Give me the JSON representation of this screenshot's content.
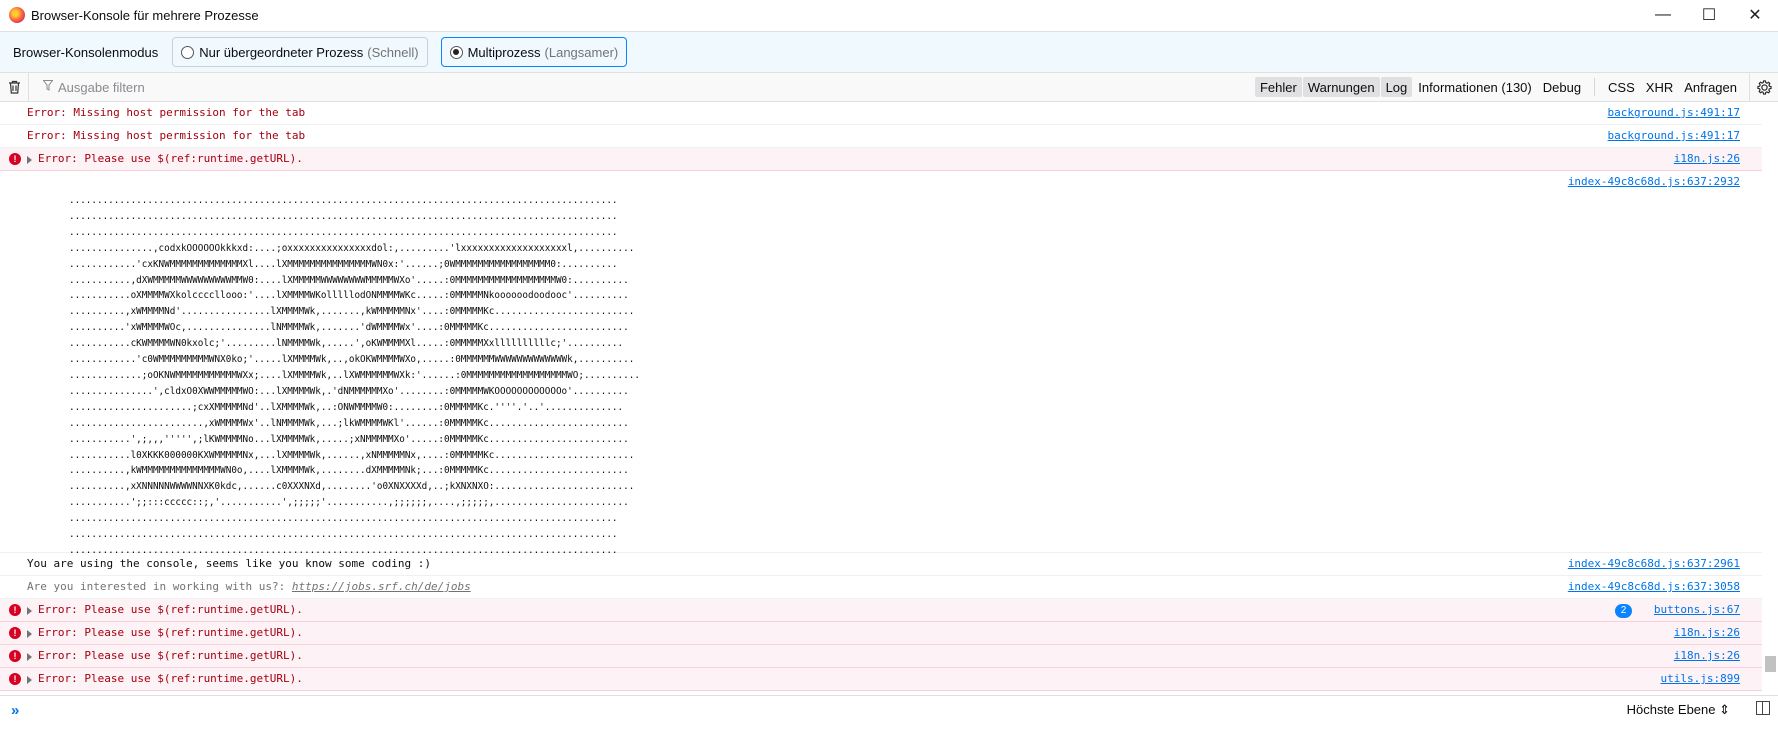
{
  "window": {
    "title": "Browser-Konsole für mehrere Prozesse",
    "minimize": "—",
    "maximize": "☐",
    "close": "✕"
  },
  "modebar": {
    "label": "Browser-Konsolenmodus",
    "option1": {
      "label": "Nur übergeordneter Prozess",
      "hint": "(Schnell)",
      "selected": false
    },
    "option2": {
      "label": "Multiprozess",
      "hint": "(Langsamer)",
      "selected": true
    }
  },
  "toolbar": {
    "filter_placeholder": "Ausgabe filtern",
    "levels": [
      {
        "label": "Fehler",
        "checked": true
      },
      {
        "label": "Warnungen",
        "checked": true
      },
      {
        "label": "Log",
        "checked": true
      },
      {
        "label": "Informationen (130)",
        "checked": false
      },
      {
        "label": "Debug",
        "checked": false
      }
    ],
    "requests": [
      "CSS",
      "XHR",
      "Anfragen"
    ]
  },
  "messages": {
    "m1": {
      "text": "Error: Missing host permission for the tab",
      "source": "background.js:491:17"
    },
    "m2": {
      "text": "Error: Missing host permission for the tab",
      "source": "background.js:491:17"
    },
    "m3": {
      "text": "Error: Please use $(ref:runtime.getURL).",
      "source": "i18n.js:26"
    },
    "ascii_source": "index-49c8c68d.js:637:2932",
    "ascii_art": "..................................................................................................\n..................................................................................................\n..................................................................................................\n...............,codxkOOOOOOkkkxd:....;oxxxxxxxxxxxxxxxdol:,.........'lxxxxxxxxxxxxxxxxxxxl,..........\n............'cxKNWMMMMMMMMMMMMMXl....lXMMMMMMMMMMMMMMMWN0x:'......;0WMMMMMMMMMMMMMMMMM0:..........\n...........,dXWMMMMMWWWWWWWWWMMW0:....lXMMMMMWWWWWWWWMMMMMWXo'.....:0MMMMMMMMMMMMMMMMMMW0:..........\n...........oXMMMMWXkolccccllooo:'....lXMMMMWKolllllodONMMMMWKc.....:0MMMMMNkoooooodoodooc'..........\n..........,xWMMMMNd'................lXMMMMWk,.......,kWMMMMMNx'....:0MMMMMKc.........................\n..........'xWMMMMWOc,...............lNMMMMWk,.......'dWMMMMWx'....:0MMMMMKc.........................\n...........cKWMMMMWN0kxolc;'.........lNMMMMWk,.....',oKWMMMMXl.....:0MMMMMXxllllllllllc;'..........\n............'c0WMMMMMMMMMWNX0ko;'.....lXMMMMWk,..,okOKWMMMMWXo,.....:0MMMMMMWWWWWWWWWWWWWk,..........\n.............;oOKNWMMMMMMMMMMMWXx;....lXMMMMWk,..lXWMMMMMMWXk:'......:0MMMMMMMMMMMMMMMMMMWO;..........\n...............',cldxO0XWWMMMMMWO:...lXMMMMWk,.'dNMMMMMMXo'........:0MMMMMWKOOOOOOOOOOOOo'..........\n......................;cxXMMMMMNd'..lXMMMMWk,..:ONWMMMMW0:........:0MMMMMKc.''''.'..'..............\n........................,xWMMMMWx'..lNMMMMWk,...;lkWMMMMWKl'......:0MMMMMKc.........................\n...........',;,,,''''',;lKWMMMMNo...lXMMMMWk,.....;xNMMMMMXo'.....:0MMMMMKc.........................\n...........l0XKKK000000KXWMMMMMNx,...lXMMMMWk,......,xNMMMMMNx,....:0MMMMMKc.........................\n..........,kWMMMMMMMMMMMMMMWN0o,....lXMMMMWk,........dXMMMMMNk;...:0MMMMMKc.........................\n..........,xXNNNNNWWWWNNXK0kdc,......c0XXXNXd,........'o0XNXXXXd,..;kXNXNXO:.........................\n...........';;:::ccccc::;,'...........',;;;;;'...........,;;;;;;,....,;;;;;,........................\n..................................................................................................\n..................................................................................................\n..................................................................................................",
    "m5": {
      "text": "You are using the console, seems like you know some coding :)",
      "source": "index-49c8c68d.js:637:2961"
    },
    "m6": {
      "prefix": "Are you interested in working with us?:",
      "link": "https://jobs.srf.ch/de/jobs",
      "source": "index-49c8c68d.js:637:3058"
    },
    "m7": {
      "text": "Error: Please use $(ref:runtime.getURL).",
      "source": "buttons.js:67",
      "badge": "2"
    },
    "m8": {
      "text": "Error: Please use $(ref:runtime.getURL).",
      "source": "i18n.js:26"
    },
    "m9": {
      "text": "Error: Please use $(ref:runtime.getURL).",
      "source": "i18n.js:26"
    },
    "m10": {
      "text": "Error: Please use $(ref:runtime.getURL).",
      "source": "utils.js:899"
    }
  },
  "inputbar": {
    "prompt": "»",
    "context": "Höchste Ebene ⇕"
  },
  "colors": {
    "error_text": "#a4000f",
    "error_bg": "#fdf2f5",
    "link": "#0074e8",
    "accent": "#0a84ff"
  }
}
